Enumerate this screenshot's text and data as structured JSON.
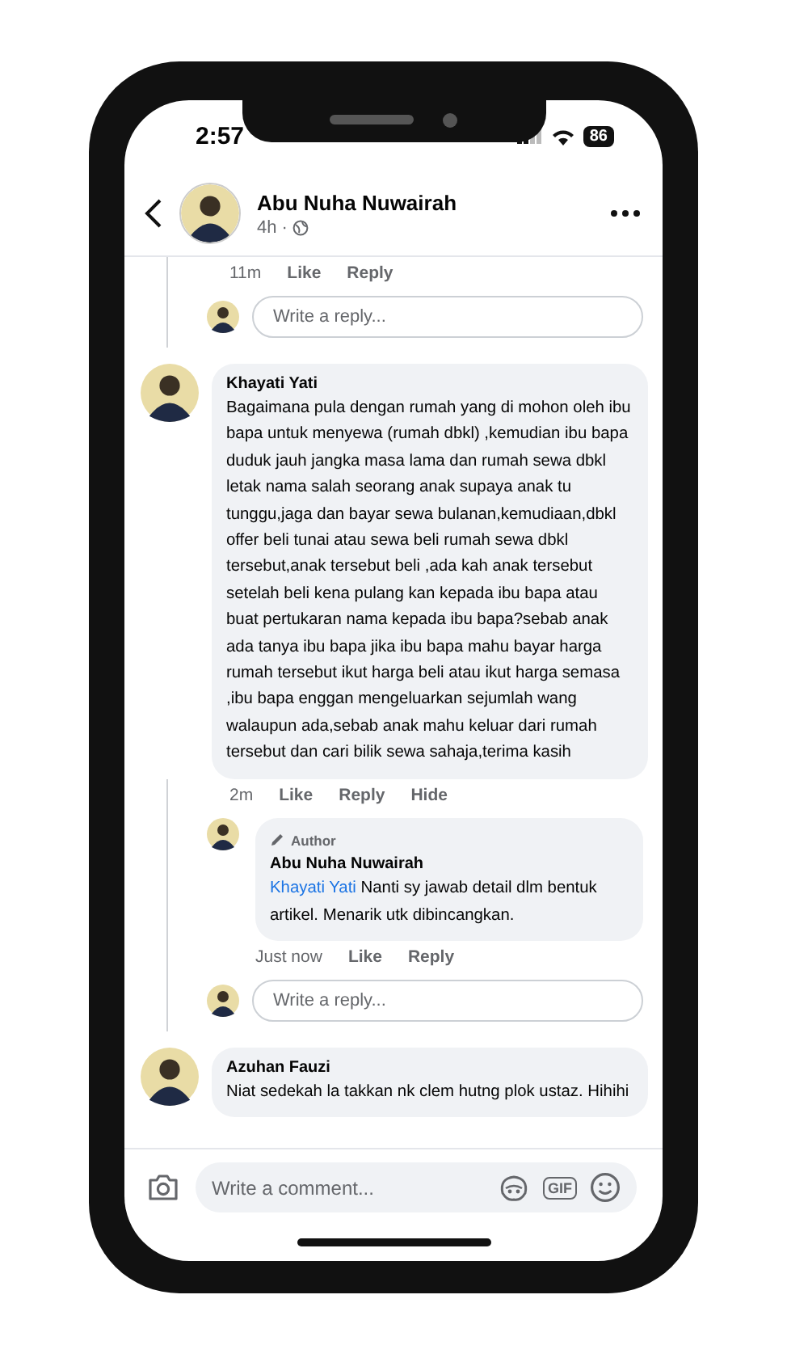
{
  "status_bar": {
    "time": "2:57",
    "battery": "86"
  },
  "header": {
    "name": "Abu Nuha Nuwairah",
    "time": "4h ·"
  },
  "previous_thread": {
    "time": "11m",
    "actions": [
      "Like",
      "Reply"
    ],
    "reply_field": {
      "placeholder": "Write a reply..."
    }
  },
  "comments": [
    {
      "name": "Khayati Yati",
      "text": "Bagaimana pula dengan rumah yang di mohon oleh ibu bapa untuk menyewa (rumah dbkl) ,kemudian ibu bapa duduk jauh jangka masa lama dan rumah sewa dbkl letak nama salah seorang anak supaya anak tu tunggu,jaga dan bayar sewa bulanan,kemudiaan,dbkl offer beli tunai atau sewa beli rumah sewa dbkl tersebut,anak tersebut beli ,ada kah anak tersebut setelah beli kena pulang kan kepada ibu bapa atau buat pertukaran nama kepada ibu bapa?sebab anak ada tanya ibu bapa jika ibu bapa mahu bayar harga rumah tersebut ikut harga beli atau ikut harga semasa ,ibu bapa enggan mengeluarkan sejumlah wang walaupun ada,sebab anak mahu keluar dari rumah tersebut dan cari bilik sewa sahaja,terima kasih",
      "time": "2m",
      "actions": [
        "Like",
        "Reply",
        "Hide"
      ],
      "replies": [
        {
          "badge": "Author",
          "name": "Abu Nuha Nuwairah",
          "mention": "Khayati Yati",
          "text": "Nanti sy jawab detail dlm bentuk artikel. Menarik utk dibincangkan.",
          "time": "Just now",
          "actions": [
            "Like",
            "Reply"
          ]
        }
      ],
      "reply_field": {
        "placeholder": "Write a reply..."
      }
    },
    {
      "name": "Azuhan Fauzi",
      "text": "Niat sedekah la takkan nk clem hutng plok ustaz. Hihihi"
    }
  ],
  "comment_bar": {
    "placeholder": "Write a comment...",
    "gif": "GIF"
  }
}
